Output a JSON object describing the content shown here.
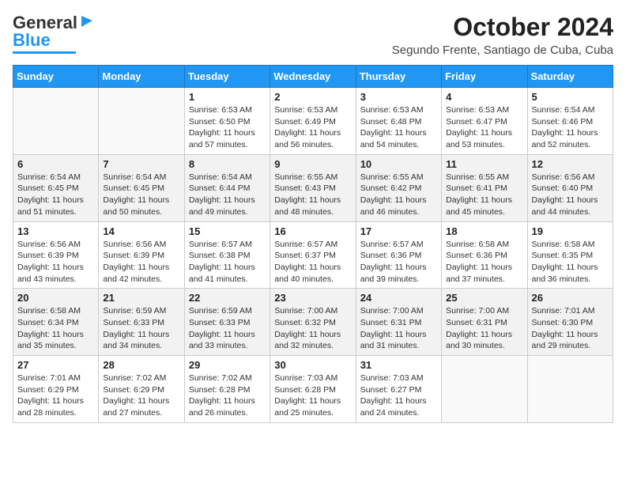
{
  "header": {
    "logo_line1": "General",
    "logo_line2": "Blue",
    "month": "October 2024",
    "location": "Segundo Frente, Santiago de Cuba, Cuba"
  },
  "weekdays": [
    "Sunday",
    "Monday",
    "Tuesday",
    "Wednesday",
    "Thursday",
    "Friday",
    "Saturday"
  ],
  "weeks": [
    [
      {
        "day": "",
        "sunrise": "",
        "sunset": "",
        "daylight": ""
      },
      {
        "day": "",
        "sunrise": "",
        "sunset": "",
        "daylight": ""
      },
      {
        "day": "1",
        "sunrise": "Sunrise: 6:53 AM",
        "sunset": "Sunset: 6:50 PM",
        "daylight": "Daylight: 11 hours and 57 minutes."
      },
      {
        "day": "2",
        "sunrise": "Sunrise: 6:53 AM",
        "sunset": "Sunset: 6:49 PM",
        "daylight": "Daylight: 11 hours and 56 minutes."
      },
      {
        "day": "3",
        "sunrise": "Sunrise: 6:53 AM",
        "sunset": "Sunset: 6:48 PM",
        "daylight": "Daylight: 11 hours and 54 minutes."
      },
      {
        "day": "4",
        "sunrise": "Sunrise: 6:53 AM",
        "sunset": "Sunset: 6:47 PM",
        "daylight": "Daylight: 11 hours and 53 minutes."
      },
      {
        "day": "5",
        "sunrise": "Sunrise: 6:54 AM",
        "sunset": "Sunset: 6:46 PM",
        "daylight": "Daylight: 11 hours and 52 minutes."
      }
    ],
    [
      {
        "day": "6",
        "sunrise": "Sunrise: 6:54 AM",
        "sunset": "Sunset: 6:45 PM",
        "daylight": "Daylight: 11 hours and 51 minutes."
      },
      {
        "day": "7",
        "sunrise": "Sunrise: 6:54 AM",
        "sunset": "Sunset: 6:45 PM",
        "daylight": "Daylight: 11 hours and 50 minutes."
      },
      {
        "day": "8",
        "sunrise": "Sunrise: 6:54 AM",
        "sunset": "Sunset: 6:44 PM",
        "daylight": "Daylight: 11 hours and 49 minutes."
      },
      {
        "day": "9",
        "sunrise": "Sunrise: 6:55 AM",
        "sunset": "Sunset: 6:43 PM",
        "daylight": "Daylight: 11 hours and 48 minutes."
      },
      {
        "day": "10",
        "sunrise": "Sunrise: 6:55 AM",
        "sunset": "Sunset: 6:42 PM",
        "daylight": "Daylight: 11 hours and 46 minutes."
      },
      {
        "day": "11",
        "sunrise": "Sunrise: 6:55 AM",
        "sunset": "Sunset: 6:41 PM",
        "daylight": "Daylight: 11 hours and 45 minutes."
      },
      {
        "day": "12",
        "sunrise": "Sunrise: 6:56 AM",
        "sunset": "Sunset: 6:40 PM",
        "daylight": "Daylight: 11 hours and 44 minutes."
      }
    ],
    [
      {
        "day": "13",
        "sunrise": "Sunrise: 6:56 AM",
        "sunset": "Sunset: 6:39 PM",
        "daylight": "Daylight: 11 hours and 43 minutes."
      },
      {
        "day": "14",
        "sunrise": "Sunrise: 6:56 AM",
        "sunset": "Sunset: 6:39 PM",
        "daylight": "Daylight: 11 hours and 42 minutes."
      },
      {
        "day": "15",
        "sunrise": "Sunrise: 6:57 AM",
        "sunset": "Sunset: 6:38 PM",
        "daylight": "Daylight: 11 hours and 41 minutes."
      },
      {
        "day": "16",
        "sunrise": "Sunrise: 6:57 AM",
        "sunset": "Sunset: 6:37 PM",
        "daylight": "Daylight: 11 hours and 40 minutes."
      },
      {
        "day": "17",
        "sunrise": "Sunrise: 6:57 AM",
        "sunset": "Sunset: 6:36 PM",
        "daylight": "Daylight: 11 hours and 39 minutes."
      },
      {
        "day": "18",
        "sunrise": "Sunrise: 6:58 AM",
        "sunset": "Sunset: 6:36 PM",
        "daylight": "Daylight: 11 hours and 37 minutes."
      },
      {
        "day": "19",
        "sunrise": "Sunrise: 6:58 AM",
        "sunset": "Sunset: 6:35 PM",
        "daylight": "Daylight: 11 hours and 36 minutes."
      }
    ],
    [
      {
        "day": "20",
        "sunrise": "Sunrise: 6:58 AM",
        "sunset": "Sunset: 6:34 PM",
        "daylight": "Daylight: 11 hours and 35 minutes."
      },
      {
        "day": "21",
        "sunrise": "Sunrise: 6:59 AM",
        "sunset": "Sunset: 6:33 PM",
        "daylight": "Daylight: 11 hours and 34 minutes."
      },
      {
        "day": "22",
        "sunrise": "Sunrise: 6:59 AM",
        "sunset": "Sunset: 6:33 PM",
        "daylight": "Daylight: 11 hours and 33 minutes."
      },
      {
        "day": "23",
        "sunrise": "Sunrise: 7:00 AM",
        "sunset": "Sunset: 6:32 PM",
        "daylight": "Daylight: 11 hours and 32 minutes."
      },
      {
        "day": "24",
        "sunrise": "Sunrise: 7:00 AM",
        "sunset": "Sunset: 6:31 PM",
        "daylight": "Daylight: 11 hours and 31 minutes."
      },
      {
        "day": "25",
        "sunrise": "Sunrise: 7:00 AM",
        "sunset": "Sunset: 6:31 PM",
        "daylight": "Daylight: 11 hours and 30 minutes."
      },
      {
        "day": "26",
        "sunrise": "Sunrise: 7:01 AM",
        "sunset": "Sunset: 6:30 PM",
        "daylight": "Daylight: 11 hours and 29 minutes."
      }
    ],
    [
      {
        "day": "27",
        "sunrise": "Sunrise: 7:01 AM",
        "sunset": "Sunset: 6:29 PM",
        "daylight": "Daylight: 11 hours and 28 minutes."
      },
      {
        "day": "28",
        "sunrise": "Sunrise: 7:02 AM",
        "sunset": "Sunset: 6:29 PM",
        "daylight": "Daylight: 11 hours and 27 minutes."
      },
      {
        "day": "29",
        "sunrise": "Sunrise: 7:02 AM",
        "sunset": "Sunset: 6:28 PM",
        "daylight": "Daylight: 11 hours and 26 minutes."
      },
      {
        "day": "30",
        "sunrise": "Sunrise: 7:03 AM",
        "sunset": "Sunset: 6:28 PM",
        "daylight": "Daylight: 11 hours and 25 minutes."
      },
      {
        "day": "31",
        "sunrise": "Sunrise: 7:03 AM",
        "sunset": "Sunset: 6:27 PM",
        "daylight": "Daylight: 11 hours and 24 minutes."
      },
      {
        "day": "",
        "sunrise": "",
        "sunset": "",
        "daylight": ""
      },
      {
        "day": "",
        "sunrise": "",
        "sunset": "",
        "daylight": ""
      }
    ]
  ]
}
